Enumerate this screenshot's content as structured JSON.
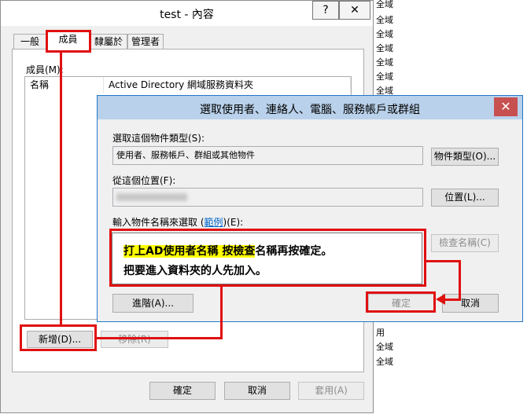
{
  "background_window": {
    "title": "test - 內容",
    "help_button": "?",
    "close_button": "✕",
    "tabs": [
      "一般",
      "成員",
      "隸屬於",
      "管理者"
    ],
    "members_label": "成員(M):",
    "columns": [
      "名稱",
      "Active Directory 網域服務資料夾"
    ],
    "add_button": "新增(D)...",
    "remove_button": "移除(R)",
    "ok_button": "確定",
    "cancel_button": "取消",
    "apply_button": "套用(A)"
  },
  "side_strip": {
    "top_items": [
      "全域",
      "全域",
      "全域",
      "全域",
      "全域",
      "全域",
      "全域",
      "全域"
    ],
    "bottom_items": [
      "用",
      "全域",
      "全域"
    ]
  },
  "dialog": {
    "title": "選取使用者、連絡人、電腦、服務帳戶或群組",
    "close_glyph": "✕",
    "object_types_label": "選取這個物件類型(S):",
    "object_types_value": "使用者、服務帳戶、群組或其他物件",
    "object_types_button": "物件類型(O)...",
    "location_label": "從這個位置(F):",
    "location_button": "位置(L)...",
    "enter_names_label_prefix": "輸入物件名稱來選取 (",
    "enter_names_link": "範例",
    "enter_names_label_suffix": ")(E):",
    "check_names_button": "檢查名稱(C)",
    "advanced_button": "進階(A)...",
    "ok_button": "確定",
    "cancel_button": "取消"
  },
  "annotation": {
    "line1_highlight": "打上AD使用者名稱 按檢查",
    "line1_rest": "名稱再按確定。",
    "line2": "把要進入資料夾的人先加入。"
  },
  "colors": {
    "annotation_red": "#e01010",
    "highlight_yellow": "#ffff00",
    "dialog_title_bg": "#b9d1ea",
    "close_red": "#c75050"
  }
}
